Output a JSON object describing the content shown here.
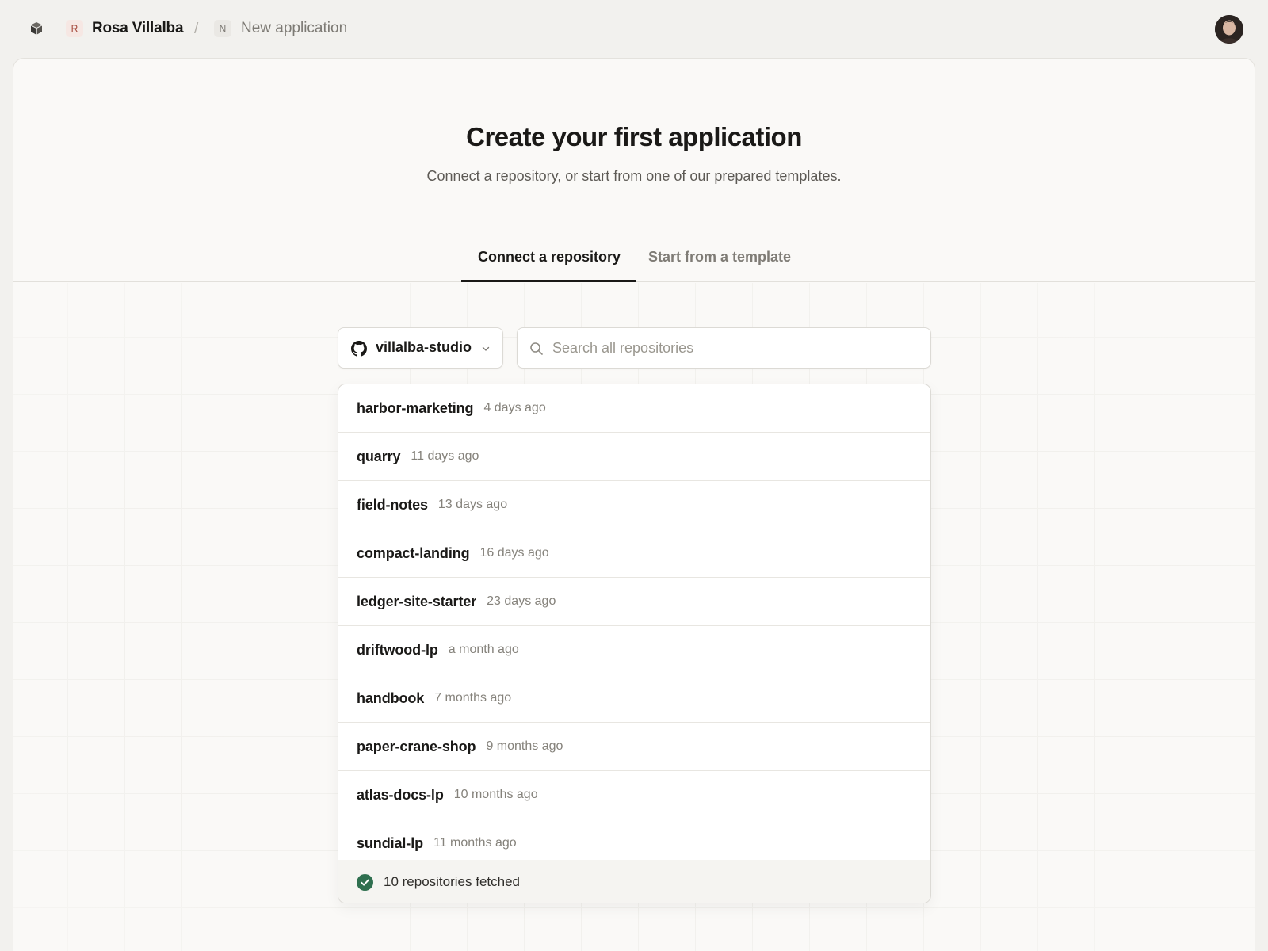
{
  "header": {
    "owner_badge": "R",
    "owner_name": "Rosa Villalba",
    "separator": "/",
    "page_badge": "N",
    "page_name": "New application"
  },
  "hero": {
    "title": "Create your first application",
    "subtitle": "Connect a repository, or start from one of our prepared templates."
  },
  "tabs": [
    {
      "label": "Connect a repository",
      "active": true
    },
    {
      "label": "Start from a template",
      "active": false
    }
  ],
  "account_select": {
    "icon": "github-icon",
    "value": "villalba-studio"
  },
  "search": {
    "placeholder": "Search all repositories"
  },
  "repositories": [
    {
      "name": "harbor-marketing",
      "updated": "4 days ago"
    },
    {
      "name": "quarry",
      "updated": "11 days ago"
    },
    {
      "name": "field-notes",
      "updated": "13 days ago"
    },
    {
      "name": "compact-landing",
      "updated": "16 days ago"
    },
    {
      "name": "ledger-site-starter",
      "updated": "23 days ago"
    },
    {
      "name": "driftwood-lp",
      "updated": "a month ago"
    },
    {
      "name": "handbook",
      "updated": "7 months ago"
    },
    {
      "name": "paper-crane-shop",
      "updated": "9 months ago"
    },
    {
      "name": "atlas-docs-lp",
      "updated": "10 months ago"
    },
    {
      "name": "sundial-lp",
      "updated": "11 months ago"
    }
  ],
  "status": {
    "icon": "check-circle-icon",
    "text": "10 repositories fetched",
    "color": "#2f6f4f"
  }
}
